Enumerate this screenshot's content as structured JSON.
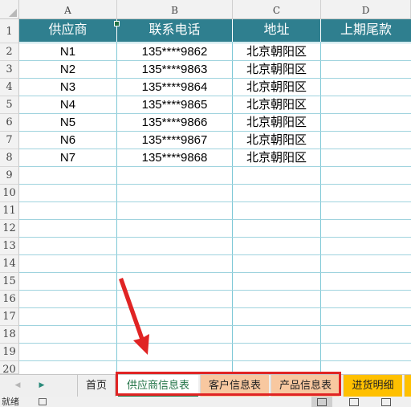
{
  "columns": [
    "A",
    "B",
    "C",
    "D"
  ],
  "row_numbers": [
    "1",
    "2",
    "3",
    "4",
    "5",
    "6",
    "7",
    "8",
    "9",
    "10",
    "11",
    "12",
    "13",
    "14",
    "15",
    "16",
    "17",
    "18",
    "19",
    "20"
  ],
  "table": {
    "headers": [
      "供应商",
      "联系电话",
      "地址",
      "上期尾款"
    ],
    "rows": [
      [
        "N1",
        "135****9862",
        "北京朝阳区",
        ""
      ],
      [
        "N2",
        "135****9863",
        "北京朝阳区",
        ""
      ],
      [
        "N3",
        "135****9864",
        "北京朝阳区",
        ""
      ],
      [
        "N4",
        "135****9865",
        "北京朝阳区",
        ""
      ],
      [
        "N5",
        "135****9866",
        "北京朝阳区",
        ""
      ],
      [
        "N6",
        "135****9867",
        "北京朝阳区",
        ""
      ],
      [
        "N7",
        "135****9868",
        "北京朝阳区",
        ""
      ]
    ]
  },
  "sheet_tabs": {
    "nav_prev_icon": "triangle-left-icon",
    "nav_next_icon": "triangle-right-icon",
    "tabs": [
      {
        "label": "首页",
        "color": "#efefef"
      },
      {
        "label": "供应商信息表",
        "color": "#ffffff",
        "active": true
      },
      {
        "label": "客户信息表",
        "color": "#f8c8a0"
      },
      {
        "label": "产品信息表",
        "color": "#f8c8a0"
      },
      {
        "label": "进货明细",
        "color": "#ffc000"
      }
    ],
    "highlight_color": "#e02424"
  },
  "status_bar": {
    "text": "就绪",
    "view_icons": [
      "normal-view-icon",
      "page-layout-icon",
      "page-break-preview-icon"
    ]
  },
  "colors": {
    "header_fill": "#2f7f8f",
    "header_text": "#ffffff",
    "grid_line": "#7ec8d6",
    "arrow": "#e02424",
    "active_tab_text": "#217346"
  }
}
